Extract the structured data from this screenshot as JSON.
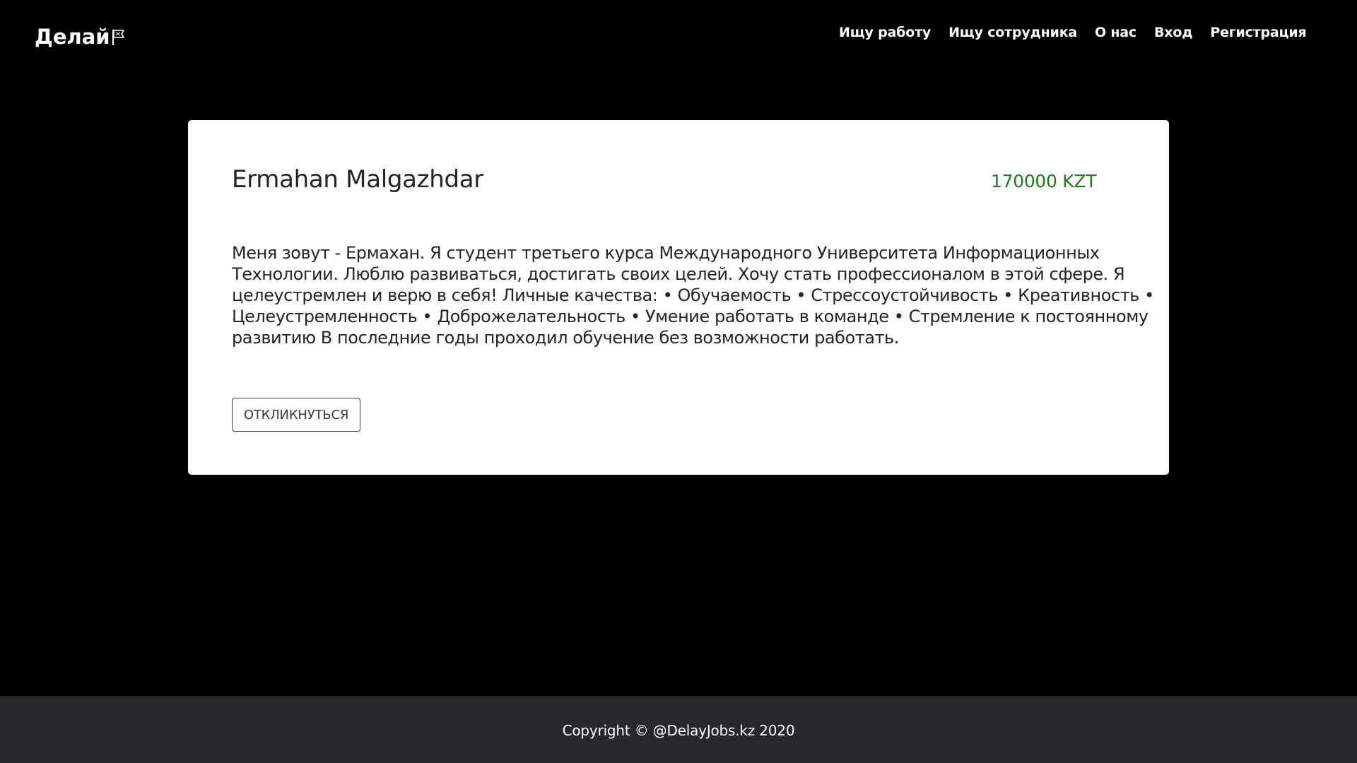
{
  "navbar": {
    "brand": "Делай",
    "brand_icon": "flag-icon",
    "links": [
      "Ищу работу",
      "Ищу сотрудника",
      "О нас",
      "Вход",
      "Регистрация"
    ]
  },
  "resume": {
    "name": "Ermahan Malgazhdar",
    "salary": "170000 KZT",
    "description": "Меня зовут - Ермахан. Я студент третьего курса Международного Университета Информационных Технологии. Люблю развиваться, достигать своих целей. Хочу стать профессионалом в этой сфере. Я целеустремлен и верю в себя! Личные качества: • Обучаемость • Стрессоустойчивость • Креативность • Целеустремленность • Доброжелательность • Умение работать в команде • Стремление к постоянному развитию В последние годы проходил обучение без возможности работать.",
    "respond_button": "ОТКЛИКНУТЬСЯ"
  },
  "footer": {
    "copyright": "Copyright © @DelayJobs.kz 2020"
  },
  "colors": {
    "background": "#000000",
    "card": "#ffffff",
    "salary": "#1f7a1f",
    "footer": "#27282d",
    "text": "#212529"
  }
}
